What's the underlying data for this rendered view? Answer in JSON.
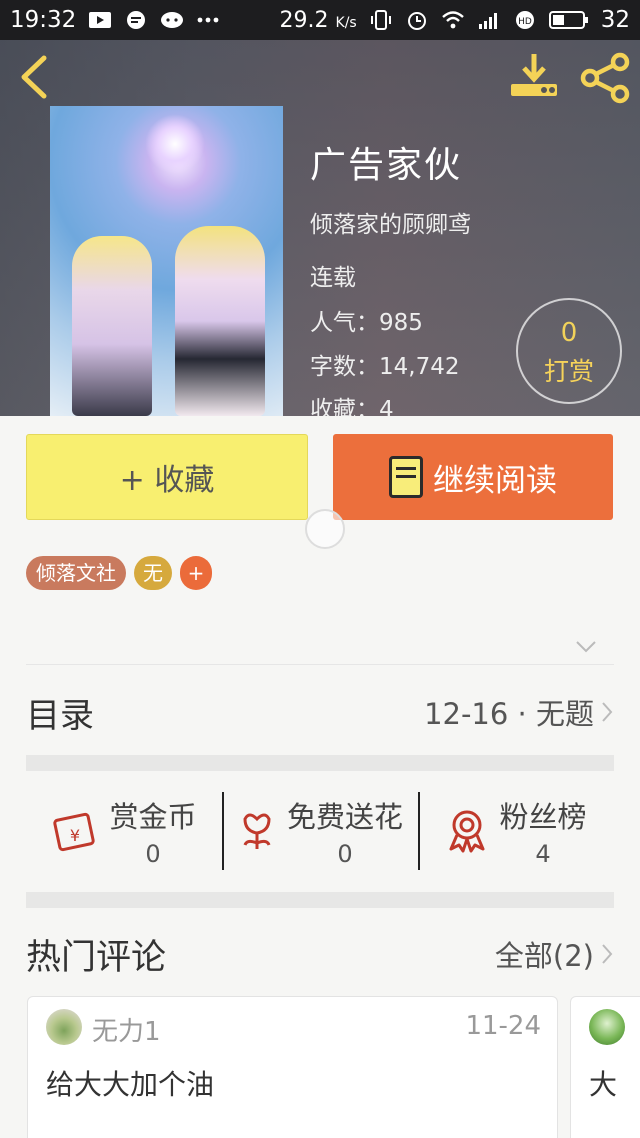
{
  "status_bar": {
    "time": "19:32",
    "speed": "29.2",
    "speed_unit": "K/s",
    "battery": "32"
  },
  "book": {
    "title": "广告家伙",
    "author": "倾落家的顾卿鸢",
    "status": "连载",
    "popularity_label": "人气：",
    "popularity": "985",
    "words_label": "字数：",
    "words": "14,742",
    "favorites_label": "收藏：",
    "favorites": "4"
  },
  "tip": {
    "count": "0",
    "label": "打赏"
  },
  "buttons": {
    "favorite": "+ 收藏",
    "continue_read": "继续阅读"
  },
  "tags": [
    "倾落文社",
    "无",
    "+"
  ],
  "toc": {
    "title": "目录",
    "latest": "12-16 · 无题"
  },
  "stats": [
    {
      "label": "赏金币",
      "value": "0",
      "icon": "red-envelope-icon"
    },
    {
      "label": "免费送花",
      "value": "0",
      "icon": "flower-icon"
    },
    {
      "label": "粉丝榜",
      "value": "4",
      "icon": "medal-icon"
    }
  ],
  "hot_comments": {
    "title": "热门评论",
    "all_label": "全部(2)",
    "items": [
      {
        "user": "无力1",
        "date": "11-24",
        "text": "给大大加个油"
      },
      {
        "user": "",
        "date": "",
        "text": "大"
      }
    ]
  },
  "colors": {
    "favorite_button": "#f8ef70",
    "read_button": "#ec6f3c",
    "tip_accent": "#f1d25a"
  }
}
